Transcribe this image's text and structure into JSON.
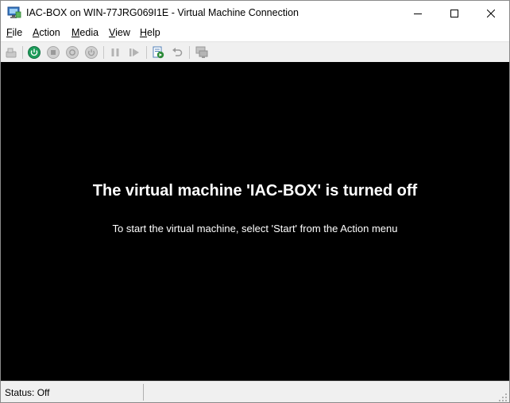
{
  "window": {
    "title": "IAC-BOX on WIN-77JRG069I1E - Virtual Machine Connection",
    "app_icon": "vm-connection-icon",
    "controls": {
      "minimize": "minimize-icon",
      "maximize": "maximize-icon",
      "close": "close-icon"
    }
  },
  "menu": {
    "items": [
      {
        "accel": "F",
        "rest": "ile"
      },
      {
        "accel": "A",
        "rest": "ction"
      },
      {
        "accel": "M",
        "rest": "edia"
      },
      {
        "accel": "V",
        "rest": "iew"
      },
      {
        "accel": "H",
        "rest": "elp"
      }
    ]
  },
  "toolbar": {
    "icons": [
      "ctrl-alt-del-icon",
      "start-icon",
      "turn-off-icon",
      "shut-down-icon",
      "save-icon",
      "pause-icon",
      "reset-icon",
      "checkpoint-icon",
      "revert-icon",
      "enhanced-session-icon"
    ],
    "colors": {
      "start_green": "#1e9c5a",
      "disabled_gray": "#a9a9a9",
      "checkpoint_green": "#2e8b3a"
    }
  },
  "screen": {
    "title": "The virtual machine 'IAC-BOX' is turned off",
    "message": "To start the virtual machine, select 'Start' from the Action menu",
    "background": "#000000"
  },
  "status": {
    "text": "Status: Off"
  }
}
